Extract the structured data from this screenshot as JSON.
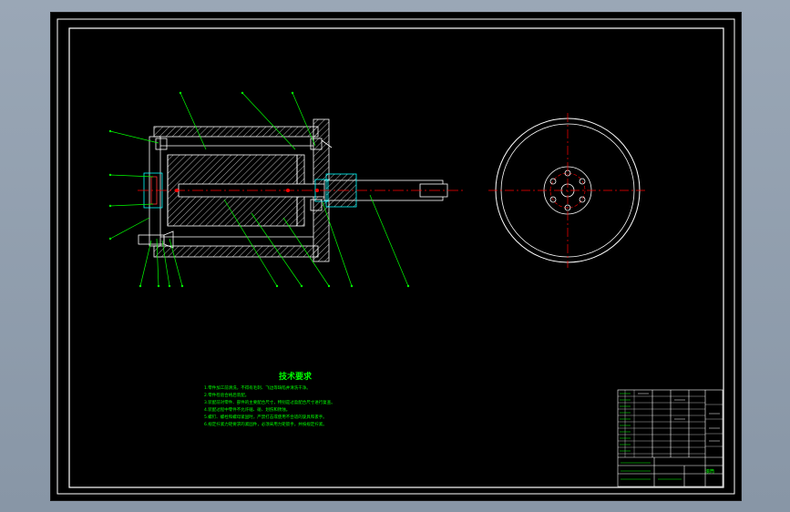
{
  "colors": {
    "background": "#000000",
    "border": "#ffffff",
    "hatch": "#ffffff",
    "leader": "#00ff00",
    "centerline": "#ff0000",
    "part_cyan": "#00ffff",
    "notes_text": "#00ff00"
  },
  "drawing": {
    "notes_title": "技术要求",
    "notes": [
      "1.零件加工前清洗，不得有毛刺、飞边等缺陷并清洗干净。",
      "2.零件检验合格后装配。",
      "3.装配前对零件、部件的主要配合尺寸，特别是过盈配合尺寸进行复查。",
      "4.装配过程中零件不允许磕、碰、划伤和锈蚀。",
      "5.螺钉、螺栓和螺母紧固时，严禁打击或使用不合适的旋具和扳手。",
      "6.规定拧紧力矩要求的紧固件，必须采用力矩扳手，并按规定拧紧。"
    ],
    "title_block_name": "滚筒"
  }
}
